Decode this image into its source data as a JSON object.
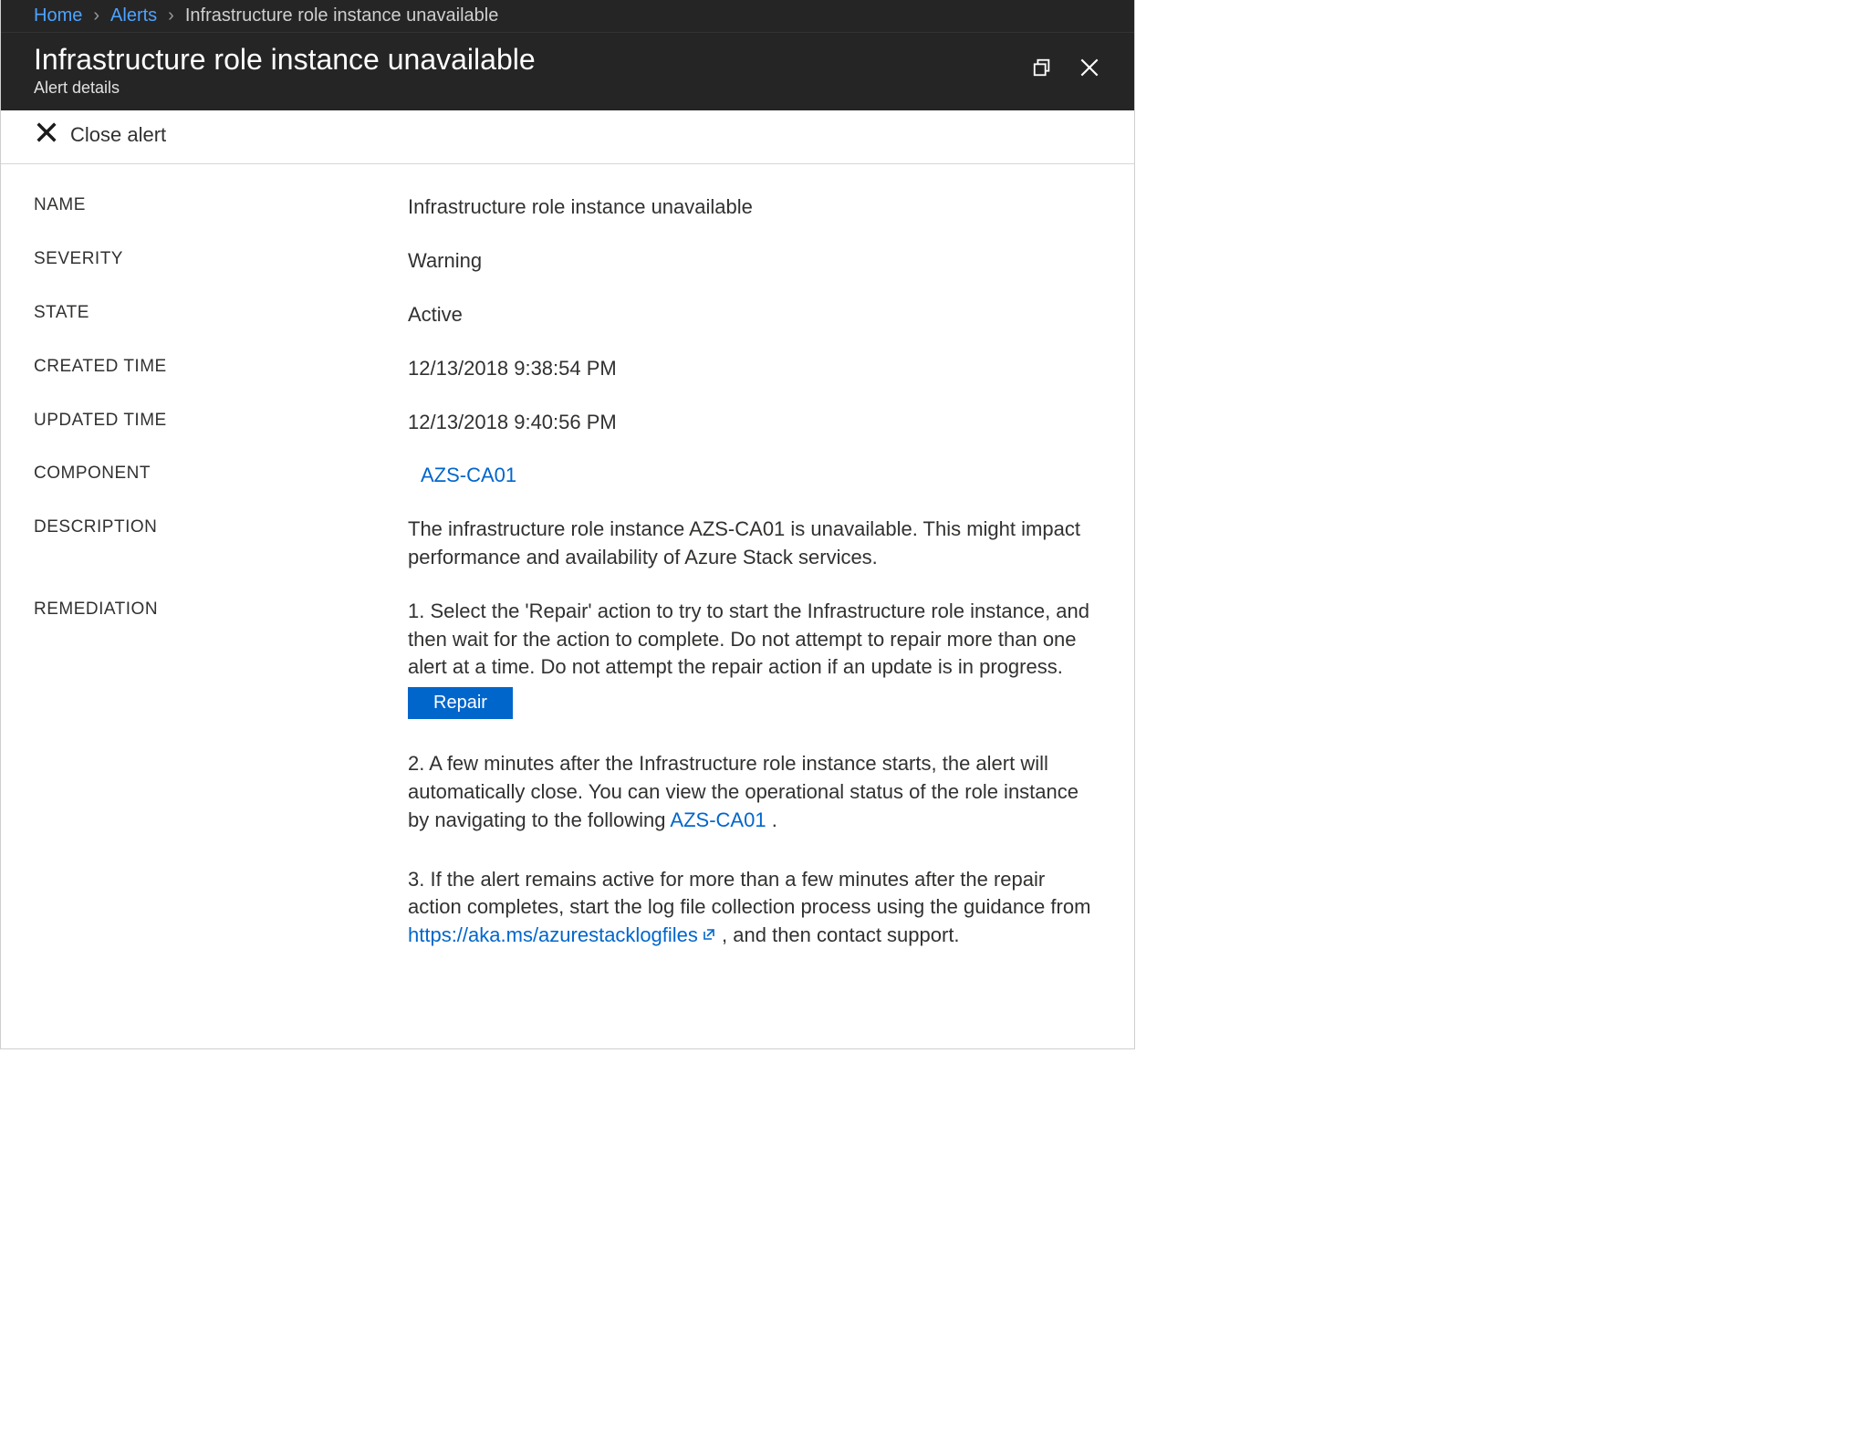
{
  "breadcrumb": {
    "home": "Home",
    "alerts": "Alerts",
    "current": "Infrastructure role instance unavailable"
  },
  "header": {
    "title": "Infrastructure role instance unavailable",
    "subtitle": "Alert details"
  },
  "toolbar": {
    "close_alert": "Close alert"
  },
  "labels": {
    "name": "NAME",
    "severity": "SEVERITY",
    "state": "STATE",
    "created": "CREATED TIME",
    "updated": "UPDATED TIME",
    "component": "COMPONENT",
    "description": "DESCRIPTION",
    "remediation": "REMEDIATION"
  },
  "values": {
    "name": "Infrastructure role instance unavailable",
    "severity": "Warning",
    "state": "Active",
    "created": "12/13/2018 9:38:54 PM",
    "updated": "12/13/2018 9:40:56 PM",
    "component": "AZS-CA01",
    "description": "The infrastructure role instance AZS-CA01 is unavailable. This might impact performance and availability of Azure Stack services."
  },
  "remediation": {
    "step1": "1. Select the 'Repair' action to try to start the Infrastructure role instance, and then wait for the action to complete. Do not attempt to repair more than one alert at a time. Do not attempt the repair action if an update is in progress.",
    "repair_button": "Repair",
    "step2_a": "2. A few minutes after the Infrastructure role instance starts, the alert will automatically close. You can view the operational status of the role instance by navigating to the following ",
    "step2_link": "AZS-CA01",
    "step2_b": " .",
    "step3_a": "3. If the alert remains active for more than a few minutes after the repair action completes, start the log file collection process using the guidance from ",
    "step3_link": "https://aka.ms/azurestacklogfiles",
    "step3_b": " , and then contact support."
  }
}
